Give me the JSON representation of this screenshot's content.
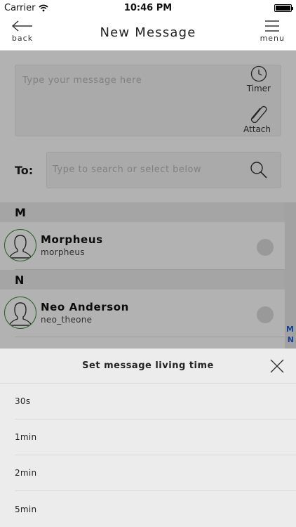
{
  "status_bar": {
    "carrier": "Carrier",
    "time": "10:46 PM"
  },
  "nav": {
    "back_label": "back",
    "title": "New Message",
    "menu_label": "menu"
  },
  "compose": {
    "placeholder": "Type your message here",
    "timer_label": "Timer",
    "attach_label": "Attach"
  },
  "recipient": {
    "label": "To:",
    "placeholder": "Type to search or select below"
  },
  "contacts": {
    "sections": [
      {
        "letter": "M",
        "items": [
          {
            "name": "Morpheus",
            "username": "morpheus"
          }
        ]
      },
      {
        "letter": "N",
        "items": [
          {
            "name": "Neo Anderson",
            "username": "neo_theone"
          }
        ]
      }
    ],
    "index": [
      "M",
      "N"
    ]
  },
  "sheet": {
    "title": "Set message living time",
    "options": [
      "30s",
      "1min",
      "2min",
      "5min"
    ]
  },
  "colors": {
    "index_accent": "#1a5fd6",
    "avatar_ring": "#3a8e3a"
  },
  "icons": {
    "back": "arrow-left-icon",
    "menu": "hamburger-icon",
    "timer": "clock-icon",
    "attach": "paperclip-icon",
    "search": "search-icon",
    "avatar": "person-silhouette-icon",
    "close": "close-icon"
  }
}
